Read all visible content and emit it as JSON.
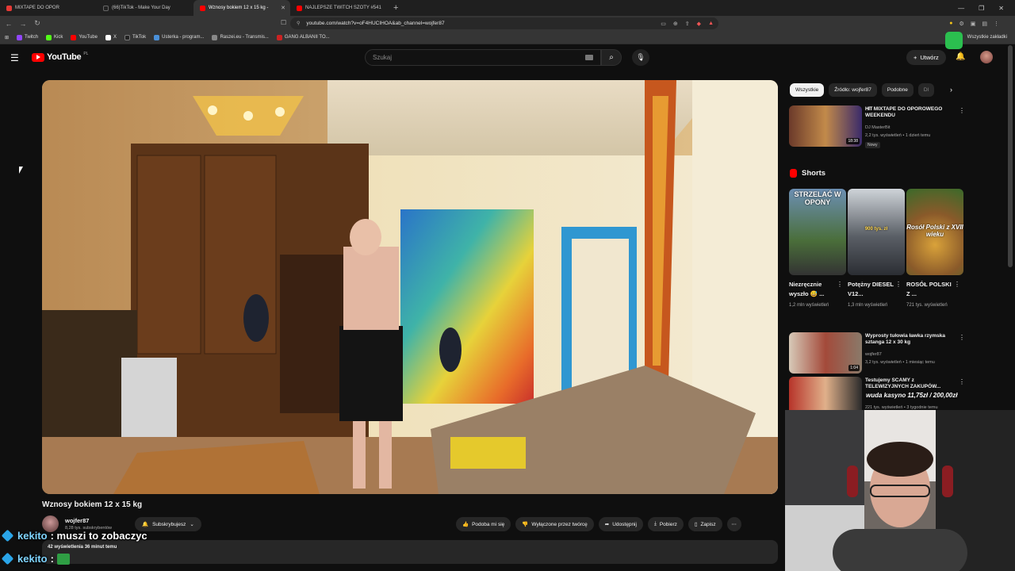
{
  "browser": {
    "tabs": [
      {
        "label": "MIXTAPE DO OPOR",
        "color": "#e53935"
      },
      {
        "label": "(66)TikTok - Make Your Day",
        "color": "#222222"
      },
      {
        "label": "Wznosy bokiem 12 x 15 kg -",
        "color": "#ff0000",
        "active": true
      },
      {
        "label": "NAJLEPSZE TWITCH SZOTY #541",
        "color": "#ff0000"
      }
    ],
    "url": "youtube.com/watch?v=oF4HUCIHOA&ab_channel=wojfer87",
    "bookmarks": [
      {
        "label": "Twitch",
        "color": "#9146ff"
      },
      {
        "label": "Kick",
        "color": "#53fc18"
      },
      {
        "label": "YouTube",
        "color": "#ff0000"
      },
      {
        "label": "X",
        "color": "#ffffff"
      },
      {
        "label": "TikTok",
        "color": "#222222"
      },
      {
        "label": "Usterka - program...",
        "color": "#4a90d9"
      },
      {
        "label": "Raszei.eu - Transmis...",
        "color": "#888888"
      },
      {
        "label": "GANG ALBANII TO...",
        "color": "#cc2222"
      }
    ],
    "bookmarks_right": "Wszystkie zakładki"
  },
  "youtube": {
    "logo": "YouTube",
    "region": "PL",
    "search_placeholder": "Szukaj",
    "create_label": "Utwórz"
  },
  "video": {
    "title": "Wznosy bokiem 12 x 15 kg",
    "channel": "wojfer87",
    "subscribers": "8,28 tys. subskrybentów",
    "subscribe_label": "Subskrybujesz",
    "like_label": "Podoba mi się",
    "dislike_label": "Wyłączone przez twórcę",
    "share_label": "Udostępnij",
    "download_label": "Pobierz",
    "save_label": "Zapisz",
    "views_meta": "42 wyświetlenia  36 minut temu"
  },
  "sidebar": {
    "chips": [
      "Wszystkie",
      "Źródło: wojfer87",
      "Podobne",
      "Dl"
    ],
    "recommendations": [
      {
        "title": "MIXTAPE DO OPOROWEGO WEEKENDU",
        "channel": "DJ MasterBit",
        "meta": "2,2 tys. wyświetleń • 1 dzień temu",
        "badge": "Nowy",
        "duration": "18:38"
      },
      {
        "title": "Wyprosty tułowia ławka rzymska sztanga 12 x 30 kg",
        "channel": "wojfer87",
        "meta": "3,2 tys. wyświetleń • 1 miesiąc temu",
        "badge": "",
        "duration": "1:04"
      },
      {
        "title": "Testujemy SCAMY z TELEWIZYJNYCH ZAKUPÓW...",
        "channel": "",
        "meta": "221 tys. wyświetleń • 3 tygodnie temu",
        "badge": "",
        "duration": ""
      }
    ],
    "shorts_label": "Shorts",
    "shorts": [
      {
        "title": "Niezręcznie wyszło 😅 ...",
        "views": "1,2 mln wyświetleń",
        "overlay": "STRZELAĆ W OPONY"
      },
      {
        "title": "Potężny DIESEL V12...",
        "views": "1,3 mln wyświetleń",
        "overlay": "900 tys. zł"
      },
      {
        "title": "ROSÓŁ POLSKI Z ...",
        "views": "721 tys. wyświetleń",
        "overlay": "Rosół Polski z XVII wieku"
      }
    ]
  },
  "overlay": {
    "donation_text": "wuda kasyno 11,75zł / 200,00zł",
    "chat": [
      {
        "user": "kekito",
        "message": ": muszi to zobaczyc"
      },
      {
        "user": "kekito",
        "message": ":"
      }
    ]
  }
}
